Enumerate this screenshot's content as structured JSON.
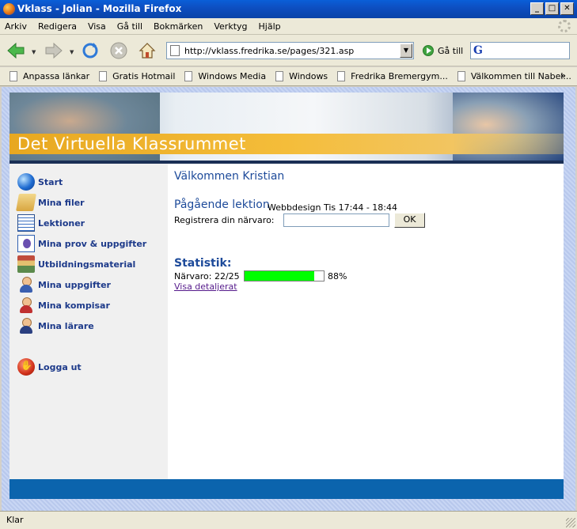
{
  "window": {
    "title": "Vklass - Jolian - Mozilla Firefox"
  },
  "menu": [
    "Arkiv",
    "Redigera",
    "Visa",
    "Gå till",
    "Bokmärken",
    "Verktyg",
    "Hjälp"
  ],
  "navbar": {
    "url": "http://vklass.fredrika.se/pages/321.asp",
    "goto_label": "Gå till"
  },
  "bookmarks": {
    "items": [
      "Anpassa länkar",
      "Gratis Hotmail",
      "Windows Media",
      "Windows",
      "Fredrika Bremergym...",
      "Välkommen till Nabel..."
    ],
    "more": "»"
  },
  "banner": {
    "title": "Det Virtuella Klassrummet"
  },
  "sidebar": {
    "items": [
      "Start",
      "Mina filer",
      "Lektioner",
      "Mina prov & uppgifter",
      "Utbildningsmaterial",
      "Mina uppgifter",
      "Mina kompisar",
      "Mina lärare"
    ],
    "logout": "Logga ut"
  },
  "main": {
    "welcome": "Välkommen Kristian",
    "lesson_heading": "Pågående lektion",
    "lesson_info": "Webbdesign Tis 17:44 - 18:44",
    "register_label": "Registrera din närvaro:",
    "register_value": "",
    "ok_label": "OK",
    "stats_heading": "Statistik:",
    "attendance_label": "Närvaro: 22/25",
    "attendance_fraction": 0.88,
    "attendance_percent": "88%",
    "detail_link": "Visa detaljerat"
  },
  "status": {
    "text": "Klar"
  },
  "colors": {
    "accent": "#0b64ad",
    "link": "#1d3a8a",
    "progress": "#00ff00"
  }
}
